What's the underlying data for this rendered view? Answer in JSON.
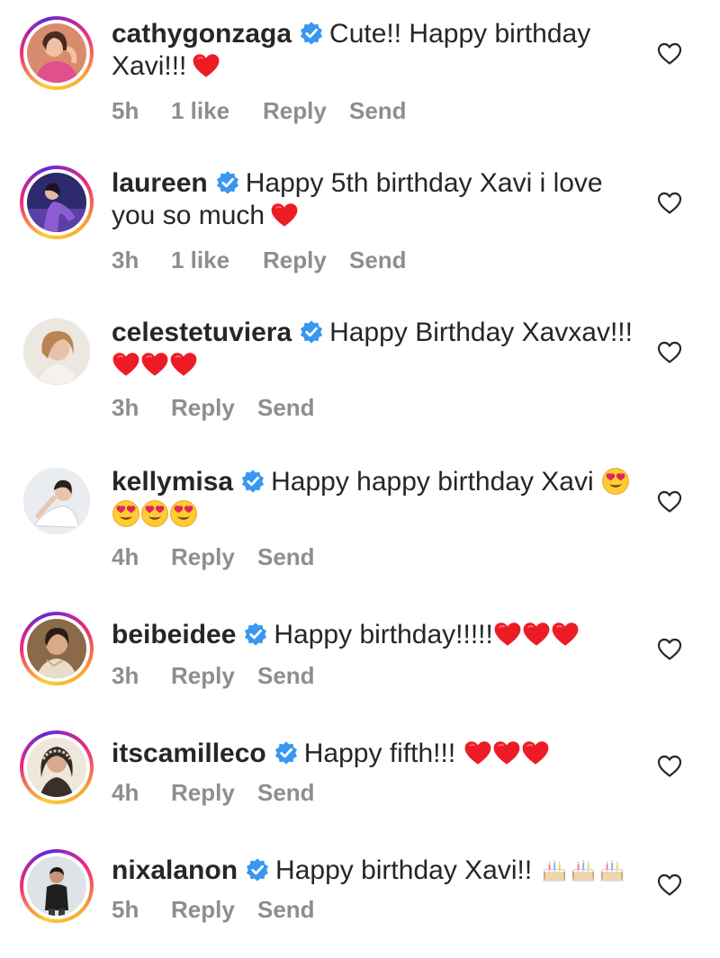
{
  "comments": [
    {
      "username": "cathygonzaga",
      "verified": true,
      "text": "Cute!! Happy birthday Xavi!!!",
      "text_line1": "Cute!! Happy birthday",
      "text_line2": "Xavi!!!",
      "emoji": "red-heart",
      "emoji_count": 1,
      "time": "5h",
      "likes": "1 like",
      "reply": "Reply",
      "send": "Send",
      "story_ring": true
    },
    {
      "username": "laureen",
      "verified": true,
      "text": "Happy 5th birthday Xavi i love you so much",
      "text_line1": "Happy 5th birthday Xavi i love",
      "text_line2": "you so much",
      "emoji": "red-heart",
      "emoji_count": 1,
      "time": "3h",
      "likes": "1 like",
      "reply": "Reply",
      "send": "Send",
      "story_ring": true
    },
    {
      "username": "celestetuviera",
      "verified": true,
      "text": "Happy Birthday Xavxav!!!",
      "text_line1": "Happy Birthday Xavxav!!!",
      "emoji": "red-heart",
      "emoji_count": 3,
      "time": "3h",
      "reply": "Reply",
      "send": "Send",
      "story_ring": false
    },
    {
      "username": "kellymisa",
      "verified": true,
      "text": "Happy happy birthday Xavi",
      "text_line1": "Happy happy birthday Xavi",
      "emoji": "heart-eyes",
      "emoji_count": 4,
      "time": "4h",
      "reply": "Reply",
      "send": "Send",
      "story_ring": false
    },
    {
      "username": "beibeidee",
      "verified": true,
      "text": "Happy birthday!!!!!",
      "text_line1": "Happy birthday!!!!!",
      "emoji": "red-heart",
      "emoji_count": 3,
      "time": "3h",
      "reply": "Reply",
      "send": "Send",
      "story_ring": true
    },
    {
      "username": "itscamilleco",
      "verified": true,
      "text": "Happy fifth!!!",
      "text_line1": "Happy fifth!!!",
      "emoji": "red-heart",
      "emoji_count": 3,
      "time": "4h",
      "reply": "Reply",
      "send": "Send",
      "story_ring": true
    },
    {
      "username": "nixalanon",
      "verified": true,
      "text": "Happy birthday Xavi!!",
      "text_line1": "Happy birthday Xavi!!",
      "emoji": "birthday-cake",
      "emoji_count": 3,
      "time": "5h",
      "reply": "Reply",
      "send": "Send",
      "story_ring": true
    }
  ],
  "colors": {
    "text": "#262626",
    "meta": "#8e8e8e",
    "verified": "#3897f0",
    "heart": "#ed1c24"
  },
  "icons": {
    "verified": "verified-badge-icon",
    "like": "heart-outline-icon"
  }
}
